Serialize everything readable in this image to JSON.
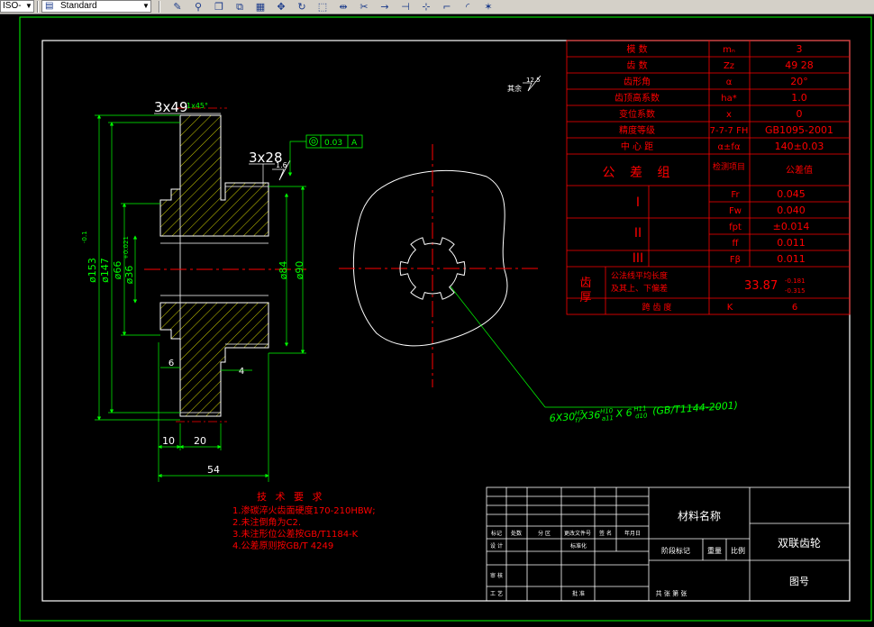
{
  "toolbar": {
    "layer_combo": "ISO-",
    "style_combo": "Standard",
    "icons": [
      "pencil-icon",
      "match-properties-icon",
      "copy-icon",
      "mirror-icon",
      "array-icon",
      "move-icon",
      "rotate-icon",
      "scale-icon",
      "stretch-icon",
      "trim-icon",
      "extend-icon",
      "break-icon",
      "break-at-point-icon",
      "chamfer-icon",
      "fillet-icon",
      "explode-icon"
    ]
  },
  "drawing": {
    "dims": {
      "d153": "ø153",
      "d153_tol": "-0.1",
      "d147": "ø147",
      "d66": "ø66",
      "d36": "ø36",
      "d36_tol": "+0.021",
      "d84": "ø84",
      "d90": "ø90",
      "w10": "10",
      "w20": "20",
      "w54": "54",
      "w6": "6",
      "w4": "4",
      "tooth49": "3x49",
      "tooth28": "3x28",
      "chamfer": "1x45°",
      "rough_small": "1.6",
      "rough_other_label": "其余",
      "rough_other": "12.5",
      "runout_value": "0.03",
      "runout_datum": "A",
      "spline": "6X30",
      "spline_f1": "H7",
      "spline_f1b": "f7",
      "spline_x2": "X36",
      "spline_f2": "H10",
      "spline_f2b": "a11",
      "spline_x3": "X 6",
      "spline_f3": "H11",
      "spline_f3b": "d10",
      "spline_std": "(GB/T1144-2001)"
    },
    "tech_req": {
      "title": "技 术 要 求",
      "lines": [
        "1.渗碳淬火齿面硬度170-210HBW;",
        "2.未注倒角为C2.",
        "3.未注形位公差按GB/T1184-K",
        "4.公差原则按GB/T 4249"
      ]
    },
    "param_table": {
      "rows": [
        {
          "name": "模   数",
          "symbol": "mₙ",
          "value": "3"
        },
        {
          "name": "齿   数",
          "symbol": "Zz",
          "value": "49   28"
        },
        {
          "name": "齿形角",
          "symbol": "α",
          "value": "20°"
        },
        {
          "name": "齿顶高系数",
          "symbol": "ha*",
          "value": "1.0"
        },
        {
          "name": "变位系数",
          "symbol": "x",
          "value": "0"
        },
        {
          "name": "精度等级",
          "symbol": "7-7-7 FH",
          "value": "GB1095-2001"
        },
        {
          "name": "中 心 距",
          "symbol": "α±fα",
          "value": "140±0.03"
        }
      ],
      "group_header": {
        "name": "公 差 组",
        "item": "检测项目",
        "value": "公差值"
      },
      "groups": [
        {
          "roman": "I",
          "items": [
            {
              "sym": "Fr",
              "val": "0.045"
            },
            {
              "sym": "Fw",
              "val": "0.040"
            }
          ]
        },
        {
          "roman": "II",
          "items": [
            {
              "sym": "fpt",
              "val": "±0.014"
            },
            {
              "sym": "ff",
              "val": "0.011"
            }
          ]
        },
        {
          "roman": "III",
          "items": [
            {
              "sym": "Fβ",
              "val": "0.011"
            }
          ]
        }
      ],
      "thickness": {
        "label1": "齿",
        "label2": "厚",
        "desc1": "公法线平均长度",
        "desc2": "及其上、下偏差",
        "value": "33.87",
        "upper": "-0.181",
        "lower": "-0.315",
        "span_label": "跨 齿 度",
        "span_sym": "K",
        "span_val": "6"
      }
    },
    "title_block": {
      "material": "材料名称",
      "part_name": "双联齿轮",
      "drawing_no": "图号",
      "weight": "重量",
      "scale": "比例",
      "stage": "阶段标记",
      "row_labels": [
        "标记",
        "处数",
        "分 区",
        "更改文件号",
        "签 名",
        "年月日"
      ],
      "design_row": [
        "设 计",
        "标准化"
      ],
      "review": "审 核",
      "process": "工 艺",
      "approve": "批 准",
      "sheet": "共 张 第 张"
    },
    "colors": {
      "outline": "#ffffff",
      "dim": "#00ff00",
      "center": "#ff0000",
      "hatch": "#ffff00",
      "table": "#ff0000",
      "text_red": "#ff0000"
    }
  }
}
